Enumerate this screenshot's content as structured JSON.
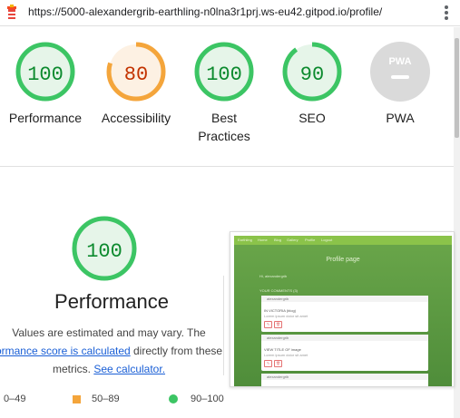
{
  "browser": {
    "url": "https://5000-alexandergrib-earthling-n0lna3r1prj.ws-eu42.gitpod.io/profile/"
  },
  "categories": [
    {
      "key": "performance",
      "label": "Performance",
      "score": 100,
      "status": "pass",
      "color": "#0c8a2e",
      "ring": "#3cc564",
      "fill": "#e6f5e9"
    },
    {
      "key": "accessibility",
      "label": "Accessibility",
      "score": 80,
      "status": "average",
      "color": "#c33300",
      "ring": "#f4a53b",
      "fill": "#fdf1e3"
    },
    {
      "key": "best-practices",
      "label": "Best Practices",
      "score": 100,
      "status": "pass",
      "color": "#0c8a2e",
      "ring": "#3cc564",
      "fill": "#e6f5e9"
    },
    {
      "key": "seo",
      "label": "SEO",
      "score": 90,
      "status": "pass",
      "color": "#0c8a2e",
      "ring": "#3cc564",
      "fill": "#e6f5e9"
    },
    {
      "key": "pwa",
      "label": "PWA",
      "score": null,
      "status": "na",
      "badge_text": "PWA"
    }
  ],
  "labels": {
    "best_practices_line1": "Best",
    "best_practices_line2": "Practices"
  },
  "performance_section": {
    "score": 100,
    "title": "Performance",
    "desc_line1": "Values are estimated and may vary. The",
    "desc_link1": "ormance score is calculated",
    "desc_mid": " directly from these",
    "desc_line3_pre": "metrics. ",
    "desc_link2": "See calculator."
  },
  "legend": {
    "fail": "0–49",
    "average": "50–89",
    "pass": "90–100"
  },
  "screenshot_preview": {
    "nav_items": [
      "Earthling",
      "Home",
      "Blog",
      "Gallery",
      "Profile",
      "Logout"
    ],
    "title": "Profile page",
    "greeting": "Hi, alexandergrib",
    "section": "YOUR COMMENTS (3)",
    "card_author": "alexandergrib",
    "card1_line1": "IN VICTORIA (blog)",
    "card1_line2": "Lorem ipsum dolor sit amet",
    "card2_line1": "VIEW TITLE OF image",
    "card2_line2": "Lorem ipsum dolor sit amet",
    "edit_glyph": "✎",
    "delete_glyph": "🗑"
  }
}
